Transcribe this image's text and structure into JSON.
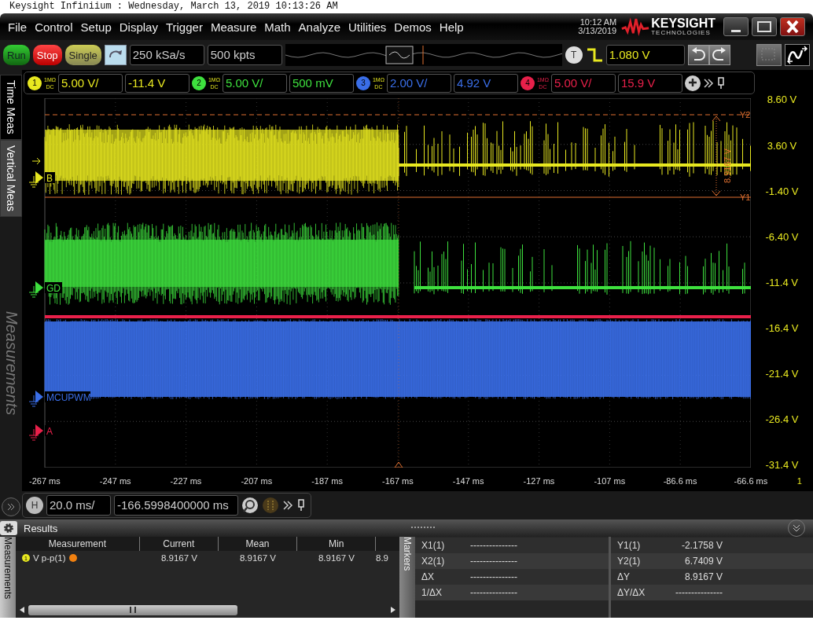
{
  "window": {
    "title": "Keysight Infiniium : Wednesday, March 13, 2019 10:13:26 AM"
  },
  "menu": [
    "File",
    "Control",
    "Setup",
    "Display",
    "Trigger",
    "Measure",
    "Math",
    "Analyze",
    "Utilities",
    "Demos",
    "Help"
  ],
  "clock": {
    "time": "10:12 AM",
    "date": "3/13/2019"
  },
  "logo": {
    "name": "KEYSIGHT",
    "tagline": "TECHNOLOGIES"
  },
  "acquisition_buttons": [
    {
      "label": "Run",
      "kind": "run"
    },
    {
      "label": "Stop",
      "kind": "stop"
    },
    {
      "label": "Single",
      "kind": "single"
    }
  ],
  "sample_rate": "250 kSa/s",
  "memory_depth": "500 kpts",
  "trigger": {
    "badge": "T",
    "level": "1.080 V"
  },
  "channels": [
    {
      "number": "1",
      "impedance": "1MΩ",
      "coupling": "DC",
      "scale": "5.00 V/",
      "offset": "-11.4 V",
      "color": "#e8e820",
      "label": "B"
    },
    {
      "number": "2",
      "impedance": "1MΩ",
      "coupling": "DC",
      "scale": "5.00 V/",
      "offset": "500 mV",
      "color": "#3ee03e",
      "label": "GD"
    },
    {
      "number": "3",
      "impedance": "1MΩ",
      "coupling": "DC",
      "scale": "2.00 V/",
      "offset": "4.92 V",
      "color": "#3a6ee8",
      "label": "MCUPWM"
    },
    {
      "number": "4",
      "impedance": "1MΩ",
      "coupling": "DC",
      "scale": "5.00 V/",
      "offset": "15.9 V",
      "color": "#e8204a",
      "label": "A"
    }
  ],
  "side_tabs": [
    {
      "label": "Time Meas",
      "selected": false
    },
    {
      "label": "Vertical Meas",
      "selected": true
    }
  ],
  "side_panel_label": "Measurements",
  "y_axis": [
    "8.60 V",
    "3.60 V",
    "-1.40 V",
    "-6.40 V",
    "-11.4 V",
    "-16.4 V",
    "-21.4 V",
    "-26.4 V",
    "-31.4 V"
  ],
  "x_axis": [
    "-267 ms",
    "-247 ms",
    "-227 ms",
    "-207 ms",
    "-187 ms",
    "-167 ms",
    "-147 ms",
    "-127 ms",
    "-107 ms",
    "-86.6 ms",
    "-66.6 ms"
  ],
  "x_axis_end": "1",
  "cursors": {
    "upper": "Y2",
    "lower": "Y1",
    "delta": "8.9167 V"
  },
  "horizontal": {
    "badge": "H",
    "scale": "20.0 ms/",
    "position": "-166.5998400000 ms"
  },
  "results": {
    "title": "Results",
    "tab": "Measurements",
    "columns": [
      "Measurement",
      "Current",
      "Mean",
      "Min"
    ],
    "rows": [
      {
        "channel": "1",
        "name": "V p-p(1)",
        "values": [
          "8.9167 V",
          "8.9167 V",
          "8.9167 V",
          "8.9"
        ]
      }
    ]
  },
  "markers": {
    "tab": "Markers",
    "left": [
      {
        "name": "X1(1)",
        "value": "---------------"
      },
      {
        "name": "X2(1)",
        "value": "---------------"
      },
      {
        "name": "ΔX",
        "value": "---------------"
      },
      {
        "name": "1/ΔX",
        "value": "---------------"
      }
    ],
    "right": [
      {
        "name": "Y1(1)",
        "value": "-2.1758 V"
      },
      {
        "name": "Y2(1)",
        "value": "6.7409 V"
      },
      {
        "name": "ΔY",
        "value": "8.9167 V"
      },
      {
        "name": "ΔY/ΔX",
        "value": "---------------"
      }
    ]
  }
}
